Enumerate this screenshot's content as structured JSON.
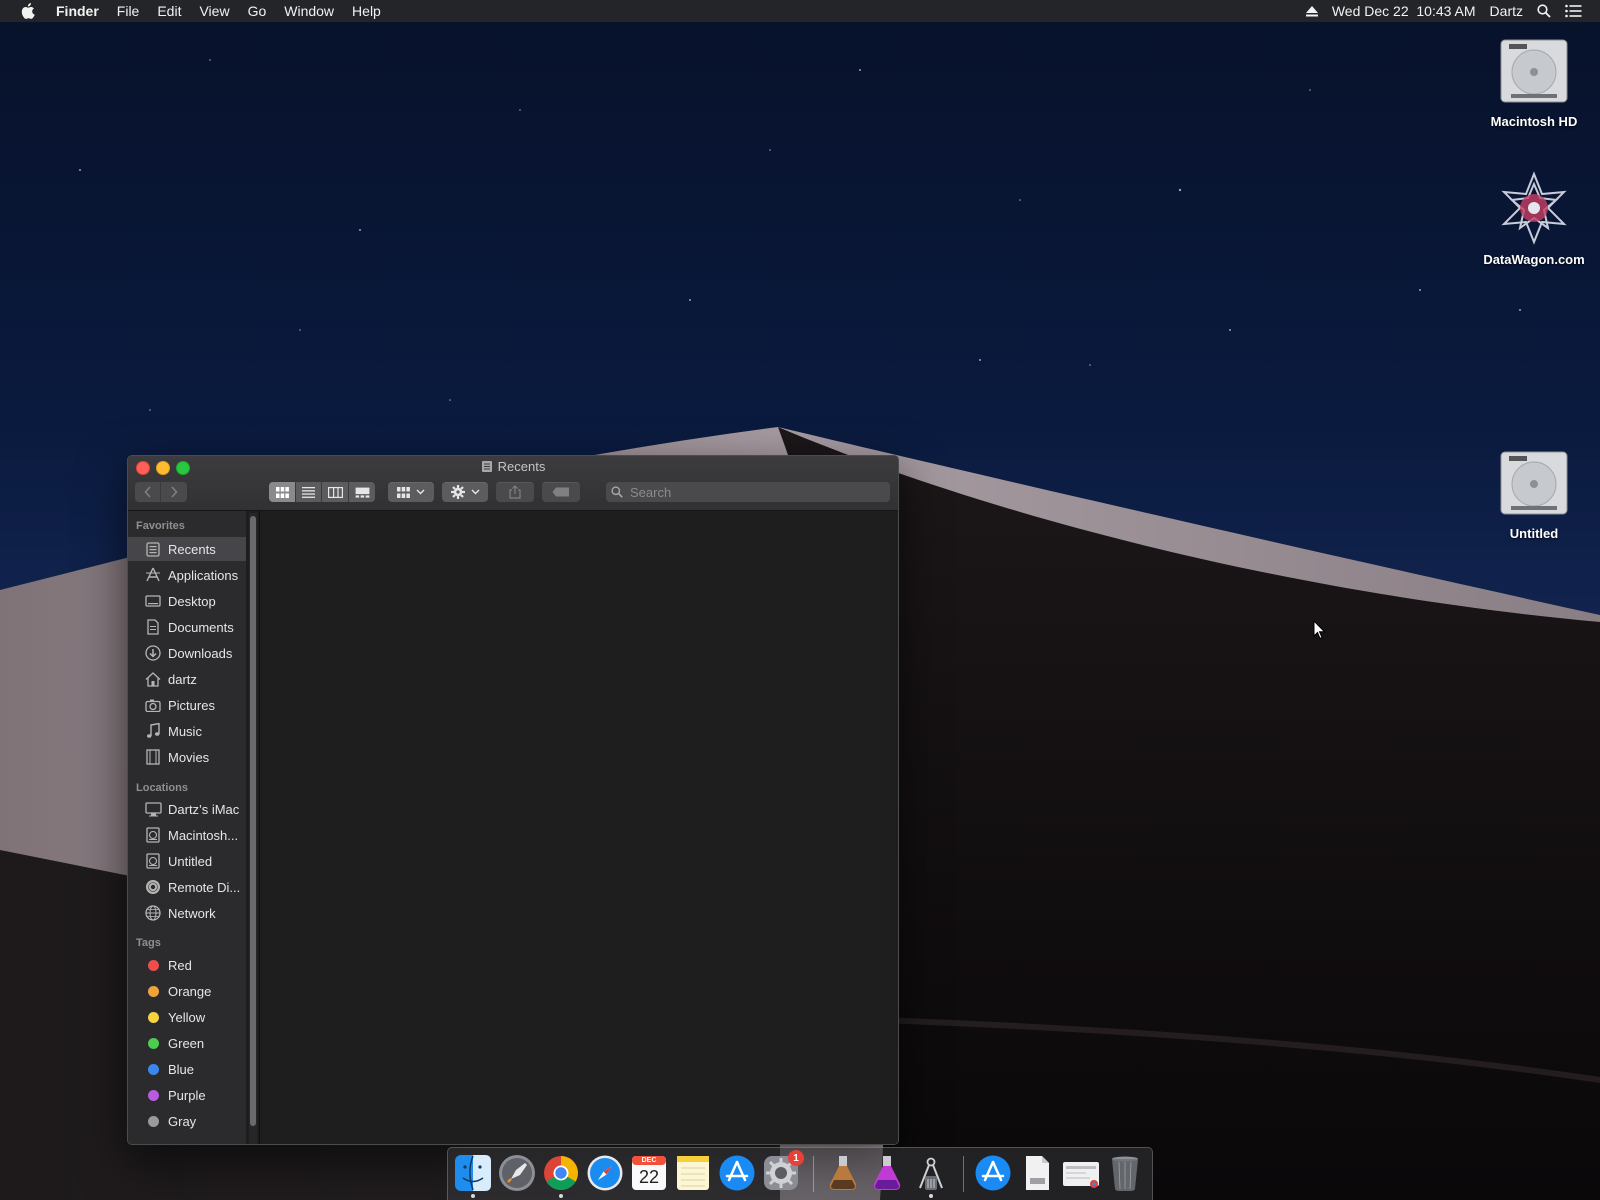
{
  "menubar": {
    "app_name": "Finder",
    "menus": [
      "File",
      "Edit",
      "View",
      "Go",
      "Window",
      "Help"
    ],
    "datetime": "Wed Dec 22  10:43 AM",
    "user": "Dartz"
  },
  "desktop_icons": [
    {
      "label": "Macintosh HD",
      "icon": "hard-drive-icon"
    },
    {
      "label": "DataWagon.com",
      "icon": "datawagon-logo-icon"
    },
    {
      "label": "Untitled",
      "icon": "hard-drive-icon"
    }
  ],
  "finder": {
    "title": "Recents",
    "search_placeholder": "Search",
    "sidebar": {
      "favorites_heading": "Favorites",
      "favorites": [
        {
          "label": "Recents",
          "icon": "recents-icon",
          "selected": true
        },
        {
          "label": "Applications",
          "icon": "applications-icon"
        },
        {
          "label": "Desktop",
          "icon": "desktop-icon"
        },
        {
          "label": "Documents",
          "icon": "documents-icon"
        },
        {
          "label": "Downloads",
          "icon": "downloads-icon"
        },
        {
          "label": "dartz",
          "icon": "home-icon"
        },
        {
          "label": "Pictures",
          "icon": "pictures-icon"
        },
        {
          "label": "Music",
          "icon": "music-icon"
        },
        {
          "label": "Movies",
          "icon": "movies-icon"
        }
      ],
      "locations_heading": "Locations",
      "locations": [
        {
          "label": "Dartz’s iMac",
          "icon": "computer-icon"
        },
        {
          "label": "Macintosh...",
          "icon": "disk-icon"
        },
        {
          "label": "Untitled",
          "icon": "disk-icon"
        },
        {
          "label": "Remote Di...",
          "icon": "remote-disc-icon"
        },
        {
          "label": "Network",
          "icon": "network-icon"
        }
      ],
      "tags_heading": "Tags",
      "tags": [
        {
          "label": "Red",
          "color": "#ee4d4a"
        },
        {
          "label": "Orange",
          "color": "#f1a33b"
        },
        {
          "label": "Yellow",
          "color": "#f5d43c"
        },
        {
          "label": "Green",
          "color": "#4ccd4e"
        },
        {
          "label": "Blue",
          "color": "#3b87ef"
        },
        {
          "label": "Purple",
          "color": "#b85be0"
        },
        {
          "label": "Gray",
          "color": "#9a9a9c"
        }
      ]
    }
  },
  "dock": {
    "apps": [
      "Finder",
      "Launchpad",
      "Google Chrome",
      "Safari",
      "Calendar",
      "Notes",
      "App Store",
      "System Preferences",
      "Install macOS High Sierra",
      "Install macOS Mojave",
      "Archive Utility",
      "App Store",
      "Document",
      "Preview",
      "Trash"
    ],
    "calendar_month": "DEC",
    "calendar_day": "22",
    "system_prefs_badge": "1"
  }
}
